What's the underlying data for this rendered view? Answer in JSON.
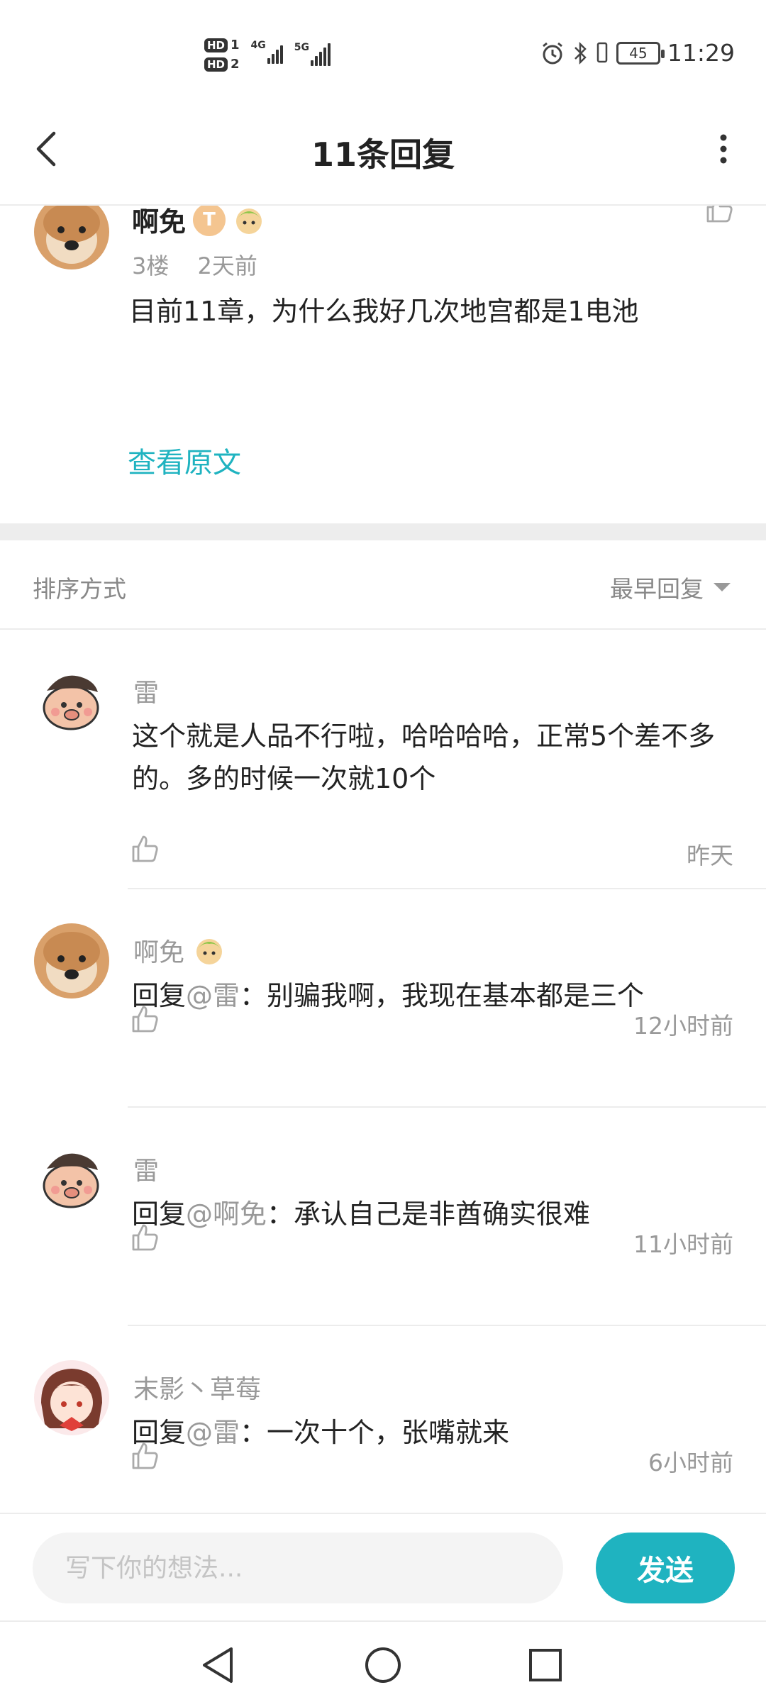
{
  "status_bar": {
    "time": "11:29",
    "battery": "45",
    "sim1": "1",
    "sim2": "2",
    "net1": "4G",
    "net2": "5G",
    "hd": "HD"
  },
  "header": {
    "title": "11条回复",
    "back_icon": "chevron-left-icon",
    "more_icon": "more-vertical-icon"
  },
  "original_comment": {
    "username": "啊免",
    "level_badge": "T",
    "floor": "3楼",
    "time": "2天前",
    "content": "目前11章，为什么我好几次地宫都是1电池",
    "view_original": "查看原文"
  },
  "sort": {
    "label": "排序方式",
    "selected": "最早回复"
  },
  "replies": [
    {
      "username": "雷",
      "prefix": "",
      "at": "",
      "text": "这个就是人品不行啦，哈哈哈哈，正常5个差不多的。多的时候一次就10个",
      "time": "昨天"
    },
    {
      "username": "啊免",
      "prefix": "回复",
      "at": "@雷",
      "text": "：别骗我啊，我现在基本都是三个",
      "time": "12小时前"
    },
    {
      "username": "雷",
      "prefix": "回复",
      "at": "@啊免",
      "text": "：承认自己是非酋确实很难",
      "time": "11小时前"
    },
    {
      "username": "末影丶草莓",
      "prefix": "回复",
      "at": "@雷",
      "text": "：一次十个，张嘴就来",
      "time": "6小时前"
    }
  ],
  "composer": {
    "placeholder": "写下你的想法...",
    "send_label": "发送"
  },
  "colors": {
    "accent": "#1fb3c0",
    "muted_text": "#999999",
    "divider": "#ececec"
  }
}
